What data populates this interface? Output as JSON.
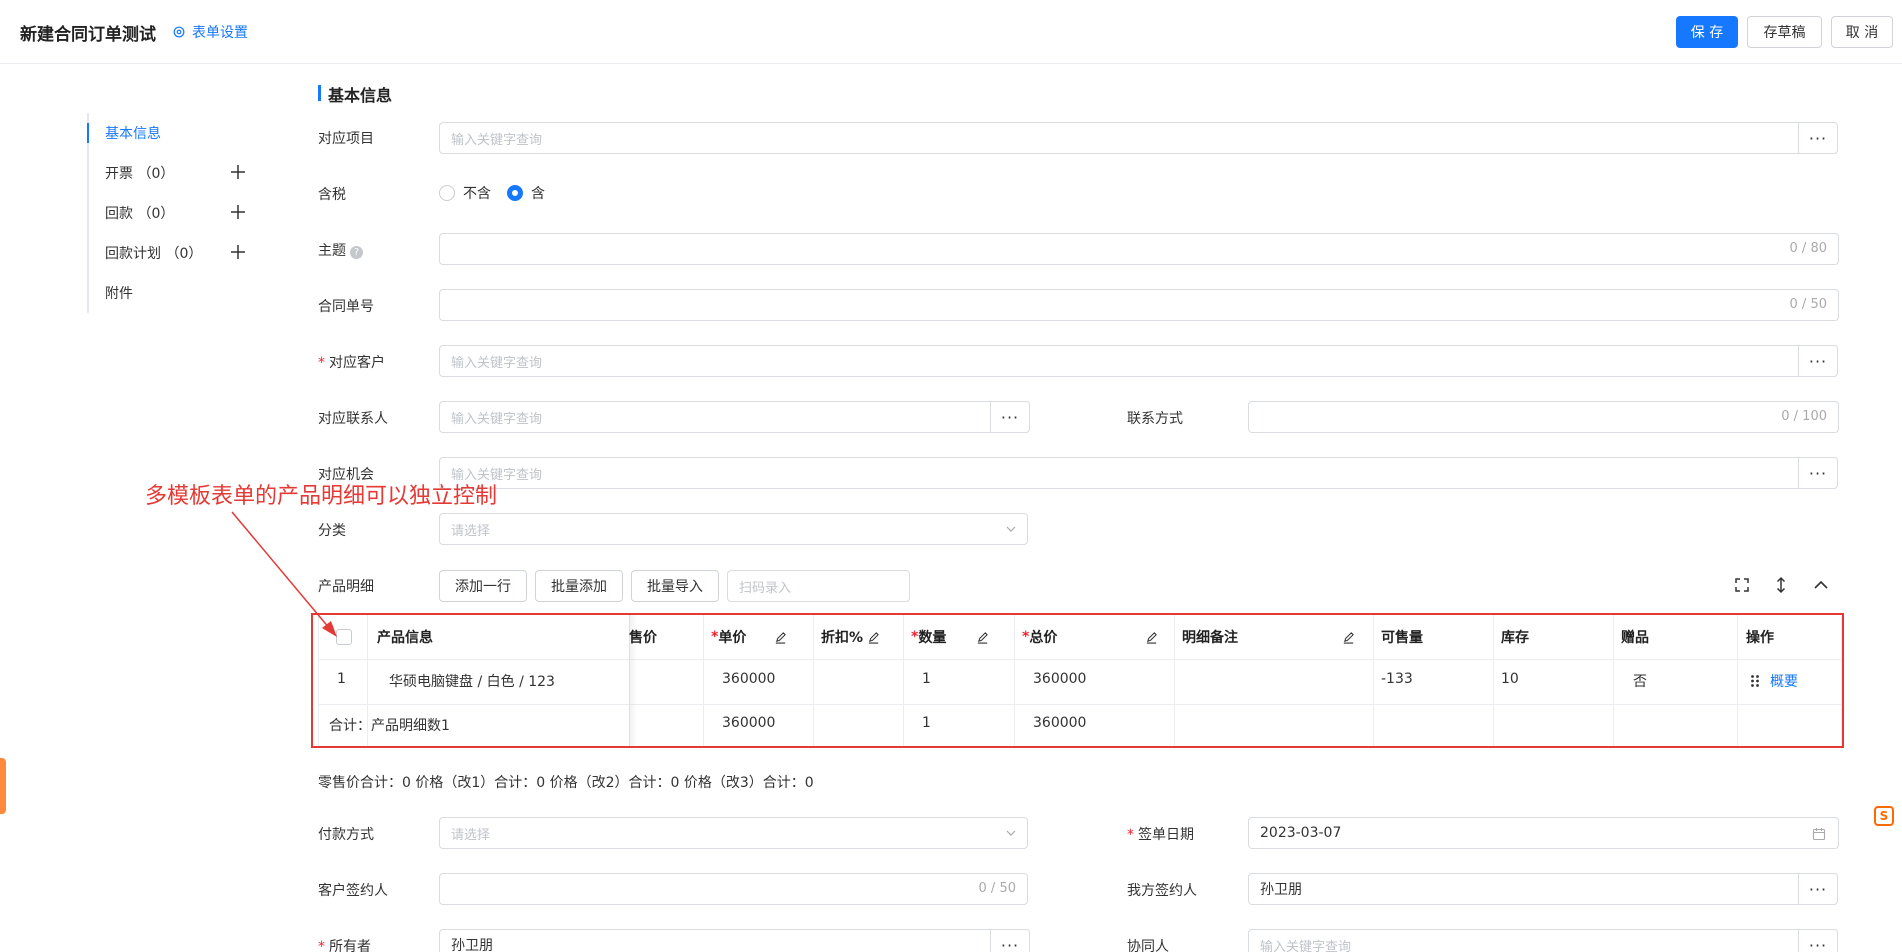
{
  "header": {
    "title": "新建合同订单测试",
    "settings_label": "表单设置",
    "save_label": "保 存",
    "draft_label": "存草稿",
    "cancel_label": "取 消"
  },
  "nav": {
    "items": [
      {
        "label": "基本信息"
      },
      {
        "label": "开票 （0）"
      },
      {
        "label": "回款 （0）"
      },
      {
        "label": "回款计划 （0）"
      },
      {
        "label": "附件"
      }
    ]
  },
  "section": {
    "title": "基本信息"
  },
  "form": {
    "project": {
      "label": "对应项目",
      "placeholder": "输入关键字查询"
    },
    "tax": {
      "label": "含税",
      "options": [
        "不含",
        "含"
      ],
      "selected": "含"
    },
    "subject": {
      "label": "主题",
      "count": "0 / 80"
    },
    "contract_no": {
      "label": "合同单号",
      "count": "0 / 50"
    },
    "customer": {
      "label": "对应客户",
      "placeholder": "输入关键字查询"
    },
    "contact": {
      "label": "对应联系人",
      "placeholder": "输入关键字查询"
    },
    "contact_method": {
      "label": "联系方式",
      "count": "0 / 100"
    },
    "opportunity": {
      "label": "对应机会",
      "placeholder": "输入关键字查询"
    },
    "category": {
      "label": "分类",
      "placeholder": "请选择"
    },
    "products": {
      "label": "产品明细",
      "add_row": "添加一行",
      "batch_add": "批量添加",
      "batch_import": "批量导入",
      "scan_placeholder": "扫码录入"
    },
    "payment": {
      "label": "付款方式",
      "placeholder": "请选择"
    },
    "sign_date": {
      "label": "签单日期",
      "value": "2023-03-07"
    },
    "customer_signer": {
      "label": "客户签约人",
      "count": "0 / 50"
    },
    "our_signer": {
      "label": "我方签约人",
      "value": "孙卫朋"
    },
    "owner": {
      "label": "所有者",
      "value": "孙卫朋"
    },
    "collaborator": {
      "label": "协同人",
      "placeholder": "输入关键字查询"
    }
  },
  "table": {
    "headers": {
      "product": "产品信息",
      "retail": "售价",
      "unit_price": "单价",
      "discount": "折扣%",
      "qty": "数量",
      "total": "总价",
      "note": "明细备注",
      "sellable": "可售量",
      "stock": "库存",
      "gift": "赠品",
      "ops": "操作"
    },
    "row": {
      "index": "1",
      "product": "华硕电脑键盘 / 白色 / 123",
      "unit_price": "360000",
      "qty": "1",
      "total": "360000",
      "sellable": "-133",
      "stock": "10",
      "gift": "否",
      "op": "概要"
    },
    "footer": {
      "label": "合计：产品明细数1",
      "unit_price": "360000",
      "qty": "1",
      "total": "360000"
    }
  },
  "summary": "零售价合计：0  价格（改1）合计：0  价格（改2）合计：0  价格（改3）合计：0",
  "annotation": "多模板表单的产品明细可以独立控制",
  "colors": {
    "accent": "#1677ff",
    "annotation": "#e53935"
  }
}
